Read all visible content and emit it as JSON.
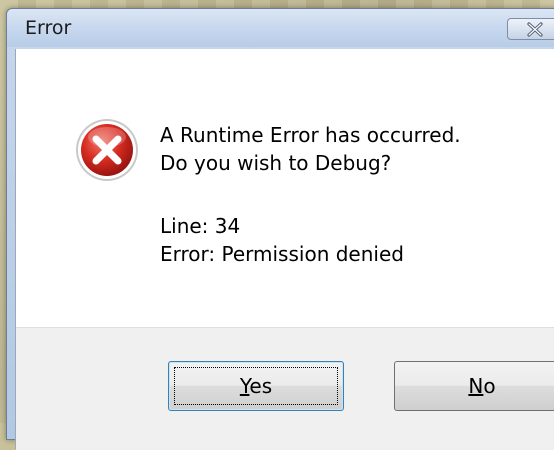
{
  "window": {
    "title": "Error"
  },
  "message": {
    "line1": "A Runtime Error has occurred.",
    "line2": "Do you wish to Debug?",
    "detail_line": "Line: 34",
    "detail_error": "Error: Permission denied"
  },
  "buttons": {
    "yes": {
      "accel": "Y",
      "rest": "es"
    },
    "no": {
      "accel": "N",
      "rest": "o"
    }
  },
  "icons": {
    "error": "error-icon",
    "close": "close-icon"
  },
  "colors": {
    "error_red": "#d62b21",
    "titlebar": "#c7d8ee",
    "button_face": "#e5e5e5"
  }
}
